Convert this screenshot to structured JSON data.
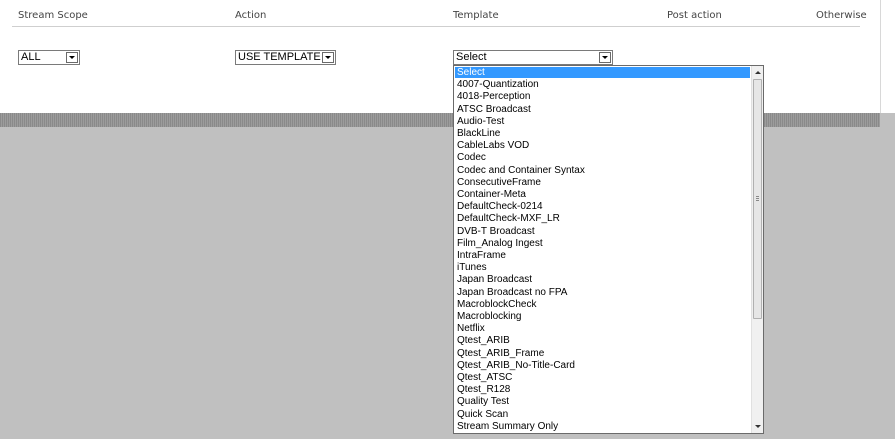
{
  "headers": {
    "stream_scope": "Stream Scope",
    "action": "Action",
    "template": "Template",
    "post_action": "Post action",
    "otherwise": "Otherwise"
  },
  "controls": {
    "stream_scope_value": "ALL",
    "action_value": "USE TEMPLATE",
    "template_value": "Select"
  },
  "template_options": [
    "Select",
    "4007-Quantization",
    "4018-Perception",
    "ATSC Broadcast",
    "Audio-Test",
    "BlackLine",
    "CableLabs VOD",
    "Codec",
    "Codec and Container Syntax",
    "ConsecutiveFrame",
    "Container-Meta",
    "DefaultCheck-0214",
    "DefaultCheck-MXF_LR",
    "DVB-T Broadcast",
    "Film_Analog Ingest",
    "IntraFrame",
    "iTunes",
    "Japan Broadcast",
    "Japan Broadcast no FPA",
    "MacroblockCheck",
    "Macroblocking",
    "Netflix",
    "Qtest_ARIB",
    "Qtest_ARIB_Frame",
    "Qtest_ARIB_No-Title-Card",
    "Qtest_ATSC",
    "Qtest_R128",
    "Quality Test",
    "Quick Scan",
    "Stream Summary Only"
  ],
  "selected_option_index": 0,
  "colors": {
    "selection": "#3399ff",
    "background": "#c0c0c0"
  }
}
